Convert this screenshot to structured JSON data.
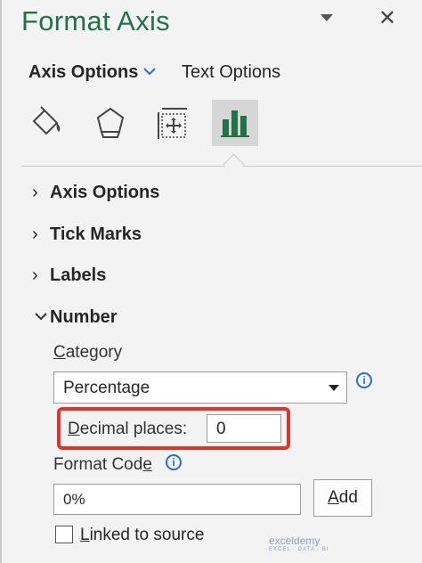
{
  "header": {
    "title": "Format Axis"
  },
  "tabs": {
    "axis_options": "Axis Options",
    "text_options": "Text Options"
  },
  "icons": [
    "fill-line-icon",
    "effects-icon",
    "size-properties-icon",
    "axis-options-icon"
  ],
  "sections": {
    "axis_options": "Axis Options",
    "tick_marks": "Tick Marks",
    "labels": "Labels",
    "number": "Number"
  },
  "number": {
    "category_label_first": "C",
    "category_label_rest": "ategory",
    "category_value": "Percentage",
    "decimal_label_first": "D",
    "decimal_label_rest": "ecimal places:",
    "decimal_value": "0",
    "format_code_label_pre": "Format Cod",
    "format_code_label_u": "e",
    "format_code_value": "0%",
    "add_first": "A",
    "add_rest": "dd",
    "linked_first": "L",
    "linked_rest": "inked to source"
  },
  "watermark": {
    "name": "exceldemy",
    "tagline": "EXCEL · DATA · BI"
  },
  "colors": {
    "accent": "#217346",
    "highlight": "#e0342b",
    "info": "#2b6fc6"
  }
}
